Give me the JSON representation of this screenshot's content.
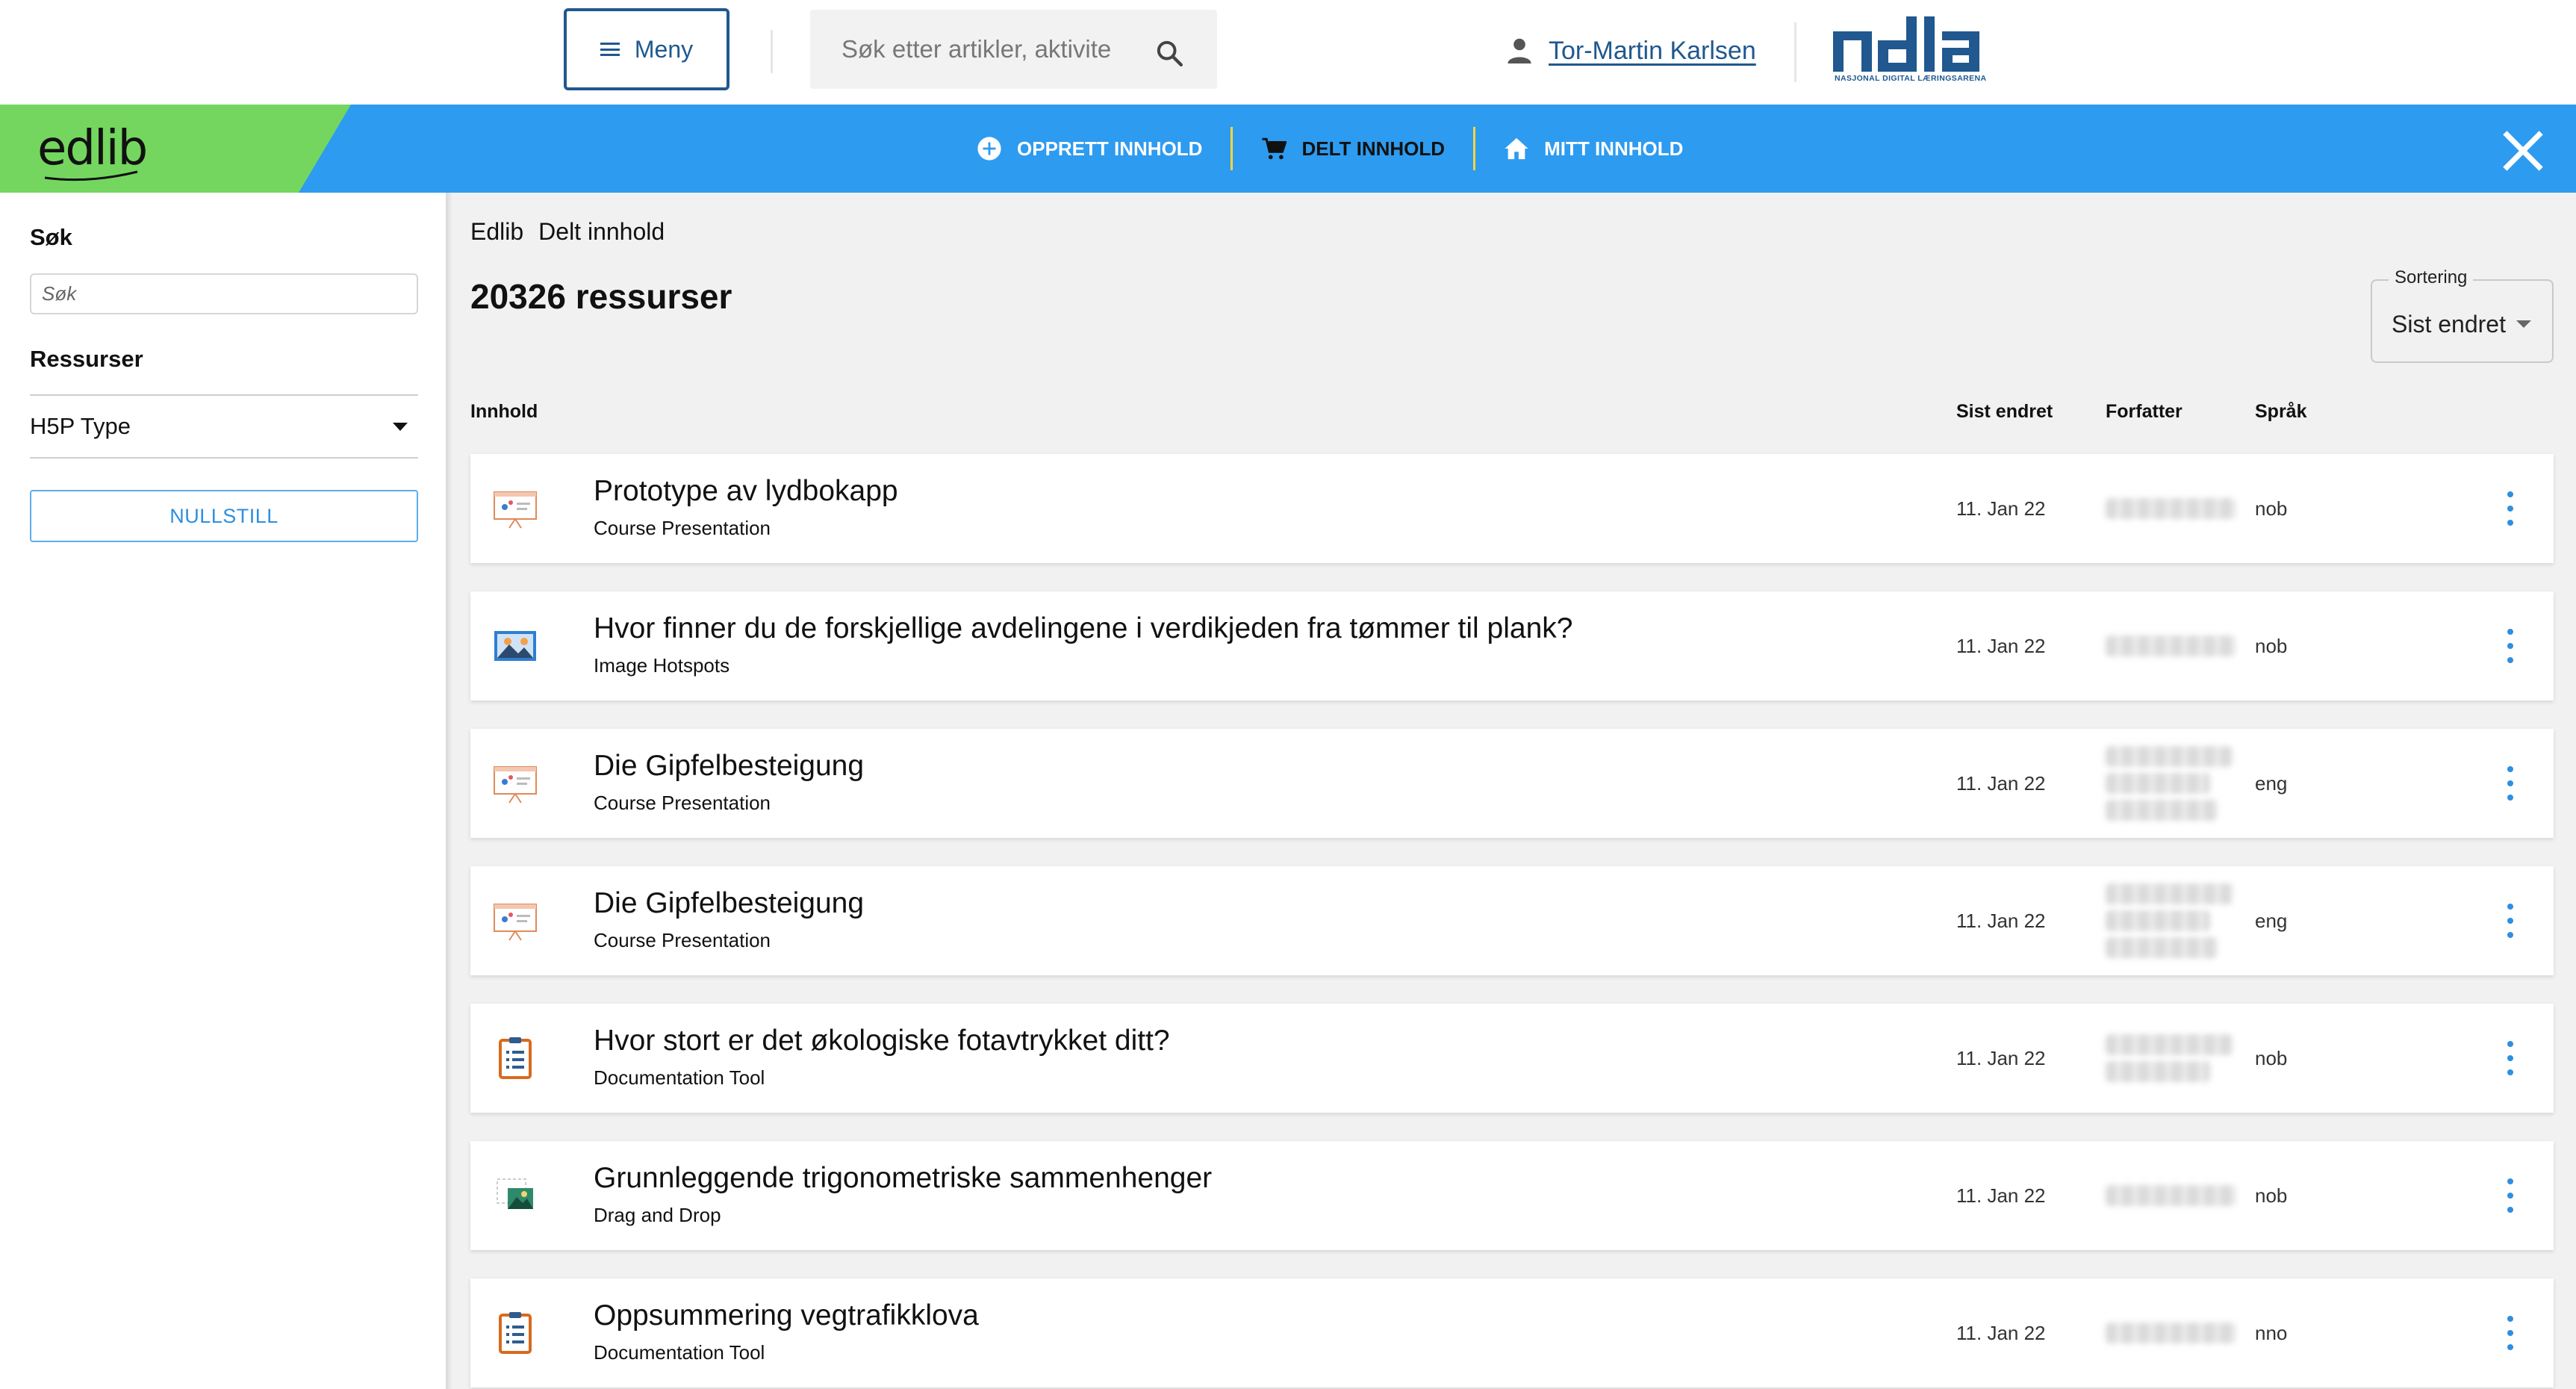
{
  "header": {
    "menu_label": "Meny",
    "search_placeholder": "Søk etter artikler, aktivite",
    "user_name": "Tor-Martin Karlsen",
    "logo_text": "ndla",
    "logo_subtitle": "NASJONAL DIGITAL LÆRINGSARENA"
  },
  "navbar": {
    "brand": "edlib",
    "items": [
      {
        "label": "OPPRETT INNHOLD",
        "icon": "plus-circle-icon",
        "active": false
      },
      {
        "label": "DELT INNHOLD",
        "icon": "cart-icon",
        "active": true
      },
      {
        "label": "MITT INNHOLD",
        "icon": "home-icon",
        "active": false
      }
    ],
    "close_icon": "close-icon",
    "colors": {
      "bar": "#2d9bf0",
      "brand_bg": "#74d65f",
      "separator": "#ffd53d"
    }
  },
  "sidebar": {
    "search_heading": "Søk",
    "search_placeholder": "Søk",
    "resources_heading": "Ressurser",
    "h5p_type_label": "H5P Type",
    "reset_label": "NULLSTILL"
  },
  "main": {
    "breadcrumb": [
      "Edlib",
      "Delt innhold"
    ],
    "count_label": "20326 ressurser",
    "sort": {
      "label": "Sortering",
      "value": "Sist endret"
    },
    "columns": {
      "content": "Innhold",
      "last_changed": "Sist endret",
      "author": "Forfatter",
      "language": "Språk"
    },
    "rows": [
      {
        "title": "Prototype av lydbokapp",
        "type": "Course Presentation",
        "icon": "course-presentation-icon",
        "date": "11. Jan 22",
        "author_lines": 1,
        "lang": "nob"
      },
      {
        "title": "Hvor finner du de forskjellige avdelingene i verdikjeden fra tømmer til plank?",
        "type": "Image Hotspots",
        "icon": "image-hotspots-icon",
        "date": "11. Jan 22",
        "author_lines": 1,
        "lang": "nob"
      },
      {
        "title": "Die Gipfelbesteigung",
        "type": "Course Presentation",
        "icon": "course-presentation-icon",
        "date": "11. Jan 22",
        "author_lines": 3,
        "lang": "eng"
      },
      {
        "title": "Die Gipfelbesteigung",
        "type": "Course Presentation",
        "icon": "course-presentation-icon",
        "date": "11. Jan 22",
        "author_lines": 3,
        "lang": "eng"
      },
      {
        "title": "Hvor stort er det økologiske fotavtrykket ditt?",
        "type": "Documentation Tool",
        "icon": "documentation-tool-icon",
        "date": "11. Jan 22",
        "author_lines": 2,
        "lang": "nob"
      },
      {
        "title": "Grunnleggende trigonometriske sammenhenger",
        "type": "Drag and Drop",
        "icon": "drag-and-drop-icon",
        "date": "11. Jan 22",
        "author_lines": 1,
        "lang": "nob"
      },
      {
        "title": "Oppsummering vegtrafikklova",
        "type": "Documentation Tool",
        "icon": "documentation-tool-icon",
        "date": "11. Jan 22",
        "author_lines": 1,
        "lang": "nno"
      }
    ]
  }
}
